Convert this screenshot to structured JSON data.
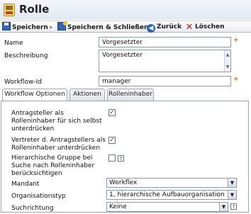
{
  "window": {
    "title": "Rolle"
  },
  "toolbar": {
    "save_label": "Speichern",
    "save_close_label": "Speichern & Schließen",
    "back_label": "Zurück",
    "delete_label": "Löschen"
  },
  "form": {
    "name_label": "Name",
    "name_value": "Vorgesetzter",
    "description_label": "Beschreibung",
    "description_value": "Vorgesetzter",
    "workflow_id_label": "Workflow-Id",
    "workflow_id_value": "manager",
    "required_mark": "*"
  },
  "tabs": [
    {
      "label": "Workflow Optionen",
      "active": true
    },
    {
      "label": "Aktionen",
      "active": false
    },
    {
      "label": "Rolleninhaber",
      "active": false
    }
  ],
  "options": {
    "suppress_applicant_label": "Antragsteller als Rolleninhaber für sich selbst unterdrücken",
    "suppress_applicant_checked": true,
    "suppress_deputy_label": "Vertreter d. Antragstellers als Rolleninhaber unterdrücken",
    "suppress_deputy_checked": true,
    "hierarchy_label": "Hierarchische Gruppe bei Suche nach Rolleninhaber berücksichtigen",
    "hierarchy_checked": false,
    "client_label": "Mandant",
    "client_value": "Workflex",
    "orgtype_label": "Organisationstyp",
    "orgtype_value": "1, hierarchische Aufbauorganisation",
    "direction_label": "Suchrichtung",
    "direction_value": "Keine"
  },
  "icons": {
    "check_mark": "✓",
    "help_mark": "?"
  },
  "colors": {
    "accent": "#3a64b5",
    "required": "#e0651a",
    "delete": "#d11b12"
  }
}
